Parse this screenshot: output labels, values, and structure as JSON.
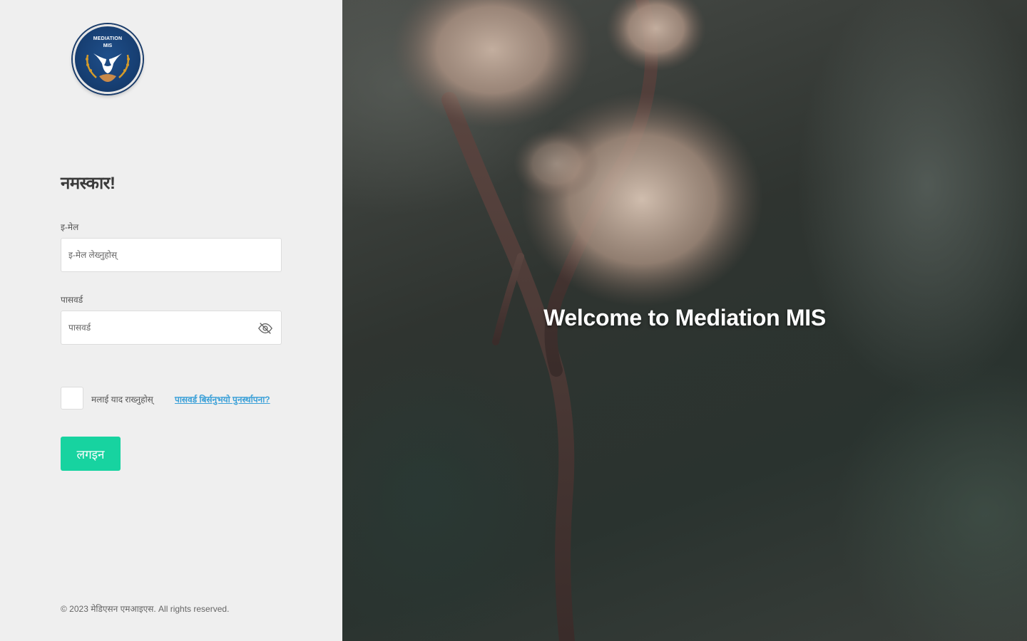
{
  "logo": {
    "line1": "MEDIATION",
    "line2": "MIS",
    "colors": {
      "bg": "#173f73",
      "emblem": "#ffffff",
      "wreath": "#d49a2a"
    }
  },
  "greeting": "नमस्कार!",
  "form": {
    "email_label": "इ-मेल",
    "email_placeholder": "इ-मेल लेख्नुहोस्",
    "password_label": "पासवर्ड",
    "password_placeholder": "पासवर्ड",
    "remember_label": "मलाई याद राख्नुहोस्",
    "forgot_link": "पासवर्ड बिर्सनुभयो पुनर्स्थापना?",
    "login_button": "लगइन"
  },
  "icons": {
    "password_toggle": "eye-slash-icon"
  },
  "footer": "© 2023 मेडिएसन एमआइएस. All rights reserved.",
  "hero": {
    "title": "Welcome to Mediation MIS"
  },
  "colors": {
    "left_bg": "#efefef",
    "accent": "#17d3a0",
    "link": "#3aa0d8"
  }
}
